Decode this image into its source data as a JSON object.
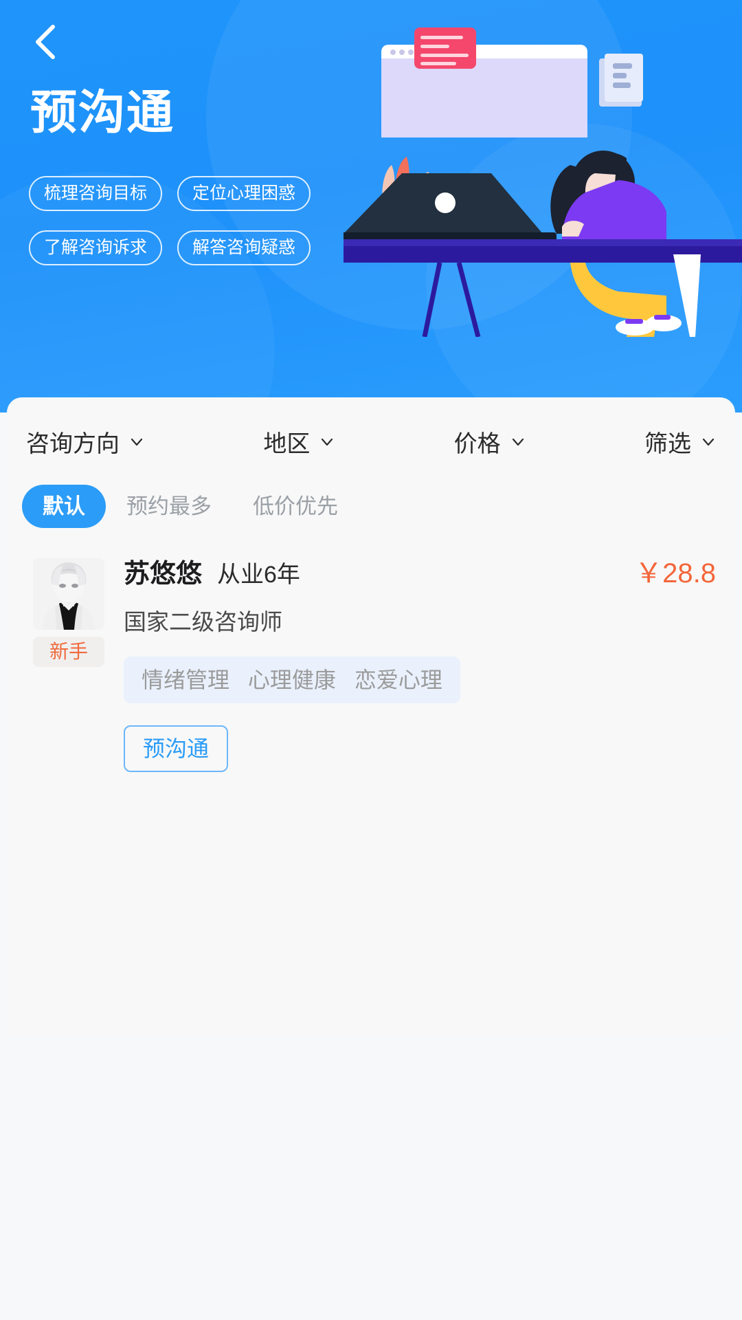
{
  "hero": {
    "back_icon": "chevron-left-icon",
    "title": "预沟通",
    "pills": [
      "梳理咨询目标",
      "定位心理困惑",
      "了解咨询诉求",
      "解答咨询疑惑"
    ]
  },
  "filters": [
    {
      "label": "咨询方向",
      "icon": "chevron-down-icon"
    },
    {
      "label": "地区",
      "icon": "chevron-down-icon"
    },
    {
      "label": "价格",
      "icon": "chevron-down-icon"
    },
    {
      "label": "筛选",
      "icon": "chevron-down-icon"
    }
  ],
  "sorts": [
    {
      "label": "默认",
      "active": true
    },
    {
      "label": "预约最多",
      "active": false
    },
    {
      "label": "低价优先",
      "active": false
    }
  ],
  "counselors": [
    {
      "name": "苏悠悠",
      "years": "从业6年",
      "price": "￥28.8",
      "badge": "新手",
      "certification": "国家二级咨询师",
      "tags": [
        "情绪管理",
        "心理健康",
        "恋爱心理"
      ],
      "action": "预沟通"
    }
  ],
  "colors": {
    "brand_blue": "#1f95fb",
    "accent_blue": "#2b9cf8",
    "price_orange": "#f4663a",
    "badge_orange": "#ef6a3c",
    "tag_bg": "#eaf1fd",
    "sheet_bg": "#f8f8f8"
  }
}
